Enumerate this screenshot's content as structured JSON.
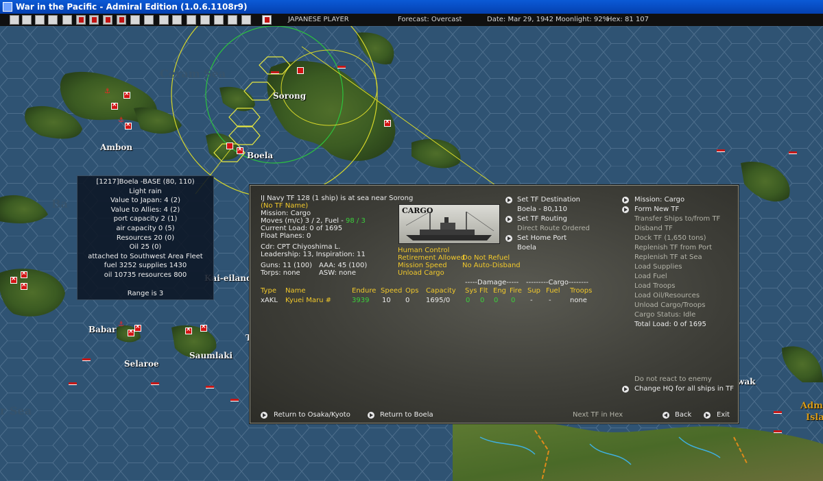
{
  "window": {
    "title": "War in the Pacific - Admiral Edition (1.0.6.1108r9)"
  },
  "status": {
    "player": "JAPANESE PLAYER",
    "forecast": "Forecast: Overcast",
    "date": "Date: Mar 29, 1942",
    "moonlight": "Moonlight: 92%",
    "hex": "Hex: 81  107"
  },
  "toolbar_icons": [
    "document-icon",
    "list-icon",
    "convoy-icon",
    "ship-icon",
    "info-icon",
    "flag-icon",
    "plane-icon",
    "sub-icon",
    "red-flag-icon",
    "ship-2-icon",
    "base-icon",
    "fleet-icon",
    "target-icon",
    "op-icon",
    "intel-icon",
    "weather-icon",
    "end-turn-icon"
  ],
  "map": {
    "labels": {
      "sorong": "Sorong",
      "ambon": "Ambon",
      "boela": "Boela",
      "babar": "Babar",
      "selaroe": "Selaroe",
      "saumlaki": "Saumlaki",
      "kai": "Kai-eilande",
      "ceram_sea": "Ceram Sea",
      "sea_left": "r Sea",
      "wak": "wak",
      "admi": "Admi",
      "isla": "Isla",
      "t_frag": "T",
      "ba_frag": "Ba",
      "nalegs": "Naleges"
    }
  },
  "base_info": {
    "lines": [
      "[1217]Boela  -BASE  (80, 110)",
      "Light rain",
      "Value to Japan:  4 (2)",
      "Value to Allies:  4 (2)",
      "port capacity 2 (1)",
      "air capacity 0 (5)",
      "Resources  20 (0)",
      "Oil  25 (0)",
      "attached to Southwest Area Fleet",
      "fuel 3252  supplies 1430",
      "oil 10735  resources 800",
      "",
      "Range is 3"
    ]
  },
  "tf": {
    "header": "IJ Navy TF 128 (1 ship) is at sea near Sorong",
    "name": "(No TF Name)",
    "mission": "Mission: Cargo",
    "moves_prefix": "Moves (m/c)  3 / 2, Fuel - ",
    "fuel": "98 / 3",
    "current_load": "Current Load:  0 of 1695",
    "float_planes": "Float Planes:  0",
    "cdr": "Cdr: CPT  Chiyoshima L.",
    "leadership": "Leadership: 13, Inspiration: 11",
    "guns": "Guns: 11 (100)",
    "aaa": "AAA: 45 (100)",
    "torps": "Torps: none",
    "asw": "ASW: none",
    "image_label": "CARGO",
    "options": {
      "human_control": "Human Control",
      "retirement": "Retirement Allowed",
      "no_refuel": "Do Not Refuel",
      "mission_speed": "Mission Speed",
      "no_disband": "No Auto-Disband",
      "unload": "Unload Cargo"
    },
    "middle": {
      "set_destination": "Set TF Destination",
      "destination": "Boela - 80,110",
      "set_routing": "Set TF Routing",
      "route": "Direct Route Ordered",
      "set_home": "Set Home Port",
      "home": "Boela"
    },
    "right": {
      "mission": "Mission: Cargo",
      "form_new": "Form New TF",
      "items": [
        "Transfer Ships to/from TF",
        "Disband TF",
        "Dock TF (1,650 tons)",
        "Replenish TF from Port",
        "Replenish TF at Sea",
        "Load Supplies",
        "Load Fuel",
        "Load Troops",
        "Load Oil/Resources",
        "Unload Cargo/Troops"
      ],
      "cargo_status": "Cargo Status: Idle",
      "total_load": "Total Load: 0 of 1695",
      "no_react": "Do not react to enemy",
      "change_hq": "Change HQ for all ships in TF"
    },
    "table": {
      "damage_header": "-----Damage-----",
      "cargo_header": "---------Cargo--------",
      "columns": [
        "Type",
        "Name",
        "Endure",
        "Speed",
        "Ops",
        "Capacity",
        "Sys",
        "Flt",
        "Eng",
        "Fire",
        "Sup",
        "Fuel",
        "Troops"
      ],
      "rows": [
        [
          "xAKL",
          "Kyuei Maru #",
          "3939",
          "10",
          "0",
          "1695/0",
          "0",
          "0",
          "0",
          "0",
          "-",
          "-",
          "none"
        ]
      ]
    },
    "footer": {
      "return_osaka": "Return to Osaka/Kyoto",
      "return_boela": "Return to Boela",
      "next_tf": "Next TF in Hex",
      "back": "Back",
      "exit": "Exit"
    }
  }
}
